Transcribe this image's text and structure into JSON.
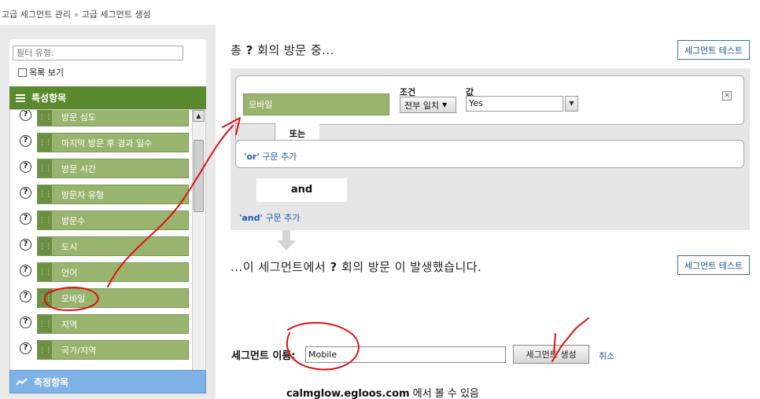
{
  "breadcrumb": {
    "item1": "고급 세그먼트 관리",
    "separator": "»",
    "item2": "고급 세그먼트 생성"
  },
  "sidebar": {
    "filter_placeholder": "필터 유형:",
    "list_view_label": "목록 보기",
    "dimensions_header": "특성항목",
    "dimensions": [
      {
        "label": "방문 심도"
      },
      {
        "label": "마지막 방문 후 경과 일수"
      },
      {
        "label": "방문 시간"
      },
      {
        "label": "방문자 유형"
      },
      {
        "label": "방문수"
      },
      {
        "label": "도시"
      },
      {
        "label": "언어"
      },
      {
        "label": "모바일"
      },
      {
        "label": "지역"
      },
      {
        "label": "국가/지역"
      }
    ],
    "metrics_header": "측정항목",
    "help_glyph": "?"
  },
  "segment": {
    "statement_top_prefix": "총",
    "statement_top_q": "?",
    "statement_top_suffix": "회의 방문 중...",
    "test_button": "세그먼트 테스트",
    "condition": {
      "dimension": "모바일",
      "condition_label": "조건",
      "condition_value": "전부 일치",
      "value_label": "값",
      "value": "Yes",
      "close_glyph": "✕"
    },
    "or_label": "또는",
    "or_clause_keyword": "'or'",
    "or_clause_text": "구문 추가",
    "and_label": "and",
    "and_clause_keyword": "'and'",
    "and_clause_text": "구문 추가",
    "statement_bottom_prefix": "...이 세그먼트에서",
    "statement_bottom_q": "?",
    "statement_bottom_suffix": "회의 방문 이 발생했습니다.",
    "name_label": "세그먼트 이름:",
    "name_value": "Mobile",
    "create_button": "세그먼트 생성",
    "cancel_link": "취소"
  },
  "watermark": {
    "site": "calmglow.egloos.com",
    "text": "에서 볼 수 있음"
  },
  "colors": {
    "dimension_green": "#99b46e",
    "header_green": "#5a8a2d",
    "metric_blue": "#7fb2e5",
    "link_blue": "#1a5aa6",
    "annotation_red": "#e01010"
  }
}
